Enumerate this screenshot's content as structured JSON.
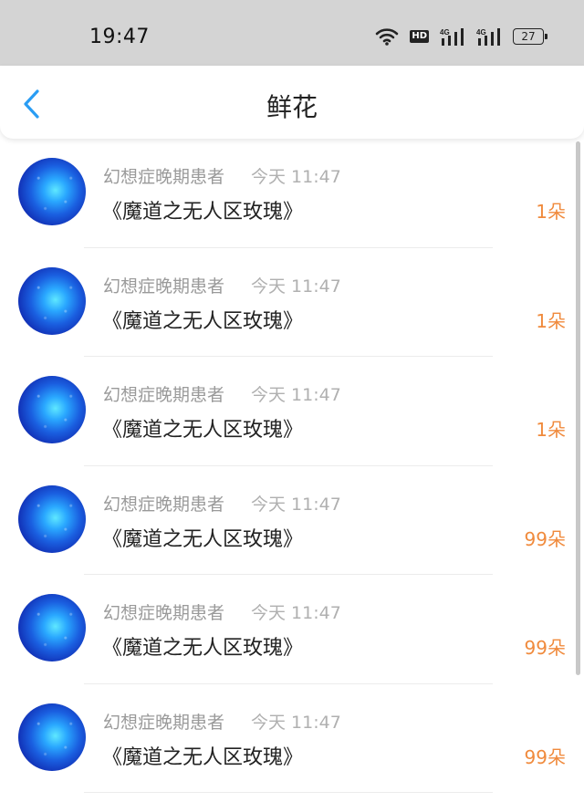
{
  "status_bar": {
    "time": "19:47",
    "hd_label": "HD",
    "network_labels": [
      "4G",
      "4G"
    ],
    "battery": "27",
    "icons": [
      "wifi-icon",
      "hd-icon",
      "signal-icon",
      "signal-icon",
      "battery-icon"
    ]
  },
  "nav": {
    "title": "鲜花",
    "back_icon": "chevron-left-icon",
    "accent": "#2a9df4"
  },
  "items": [
    {
      "sender": "幻想症晚期患者",
      "time": "今天 11:47",
      "title": "《魔道之无人区玫瑰》",
      "count": "1朵"
    },
    {
      "sender": "幻想症晚期患者",
      "time": "今天 11:47",
      "title": "《魔道之无人区玫瑰》",
      "count": "1朵"
    },
    {
      "sender": "幻想症晚期患者",
      "time": "今天 11:47",
      "title": "《魔道之无人区玫瑰》",
      "count": "1朵"
    },
    {
      "sender": "幻想症晚期患者",
      "time": "今天 11:47",
      "title": "《魔道之无人区玫瑰》",
      "count": "99朵"
    },
    {
      "sender": "幻想症晚期患者",
      "time": "今天 11:47",
      "title": "《魔道之无人区玫瑰》",
      "count": "99朵"
    },
    {
      "sender": "幻想症晚期患者",
      "time": "今天 11:47",
      "title": "《魔道之无人区玫瑰》",
      "count": "99朵"
    }
  ],
  "colors": {
    "count_orange": "#f08a3c",
    "status_bar_bg": "#d4d4d4"
  }
}
